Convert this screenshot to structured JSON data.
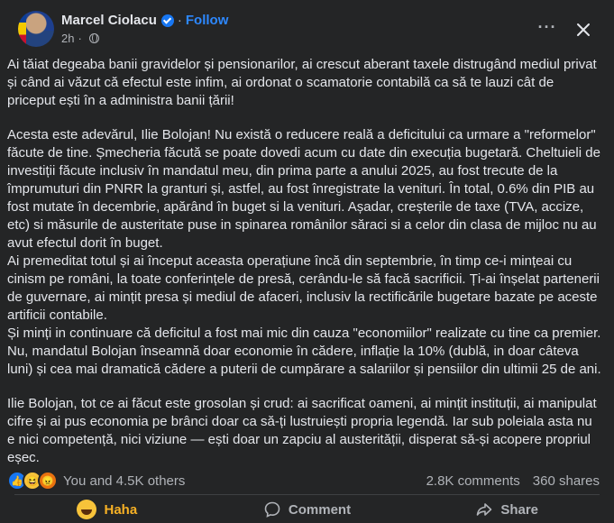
{
  "post": {
    "author": "Marcel Ciolacu",
    "separator": "·",
    "follow_label": "Follow",
    "time": "2h",
    "privacy_icon": "globe-icon",
    "more_icon": "more-horizontal-icon",
    "close_icon": "close-icon",
    "paragraphs": [
      "Ai tăiat degeaba banii gravidelor și pensionarilor, ai crescut aberant taxele distrugând mediul privat și când ai văzut că efectul este infim, ai ordonat o scamatorie contabilă ca să te lauzi cât de priceput ești în a administra banii țării!",
      "Acesta este adevărul, Ilie Bolojan! Nu există o reducere reală a deficitului ca urmare a \"reformelor\" făcute de tine. Șmecheria făcută se poate dovedi acum cu date din execuția bugetară.  Cheltuieli de investiții făcute inclusiv în mandatul meu, din prima parte a anului 2025, au fost trecute de la împrumuturi din PNRR la granturi și, astfel, au fost înregistrate la venituri. În total, 0.6% din PIB au fost mutate în decembrie, apărând în buget si la venituri. Așadar, creșterile de taxe (TVA, accize, etc) si măsurile de austeritate puse in spinarea românilor  săraci si a celor din clasa de mijloc nu au avut efectul dorit în buget.",
      "Ai premeditat totul și ai început aceasta operațiune încă din septembrie, în timp ce-i mințeai cu cinism pe români, la toate conferințele de presă, cerându-le să facă sacrificii. Ți-ai înșelat partenerii de guvernare, ai mințit presa și mediul de afaceri, inclusiv la rectificările bugetare bazate pe aceste artificii contabile.",
      "Și minți in continuare că deficitul a fost mai mic din cauza \"economiilor\" realizate cu tine ca premier. Nu, mandatul Bolojan înseamnă doar economie în cădere, inflație la 10% (dublă, in doar câteva luni) și cea mai dramatică cădere a puterii de cumpărare a salariilor și pensiilor din ultimii 25 de ani.",
      "Ilie Bolojan, tot ce ai făcut este grosolan și crud: ai sacrificat oameni, ai mințit instituții, ai manipulat cifre și ai pus economia pe brânci doar ca să-ți lustruiești propria legendă. Iar sub poleiala asta nu e nici competență, nici viziune — ești doar un zapciu al austerității, disperat să-și acopere propriul eșec."
    ]
  },
  "reactions": {
    "icons": [
      "like-icon",
      "haha-icon",
      "angry-icon"
    ],
    "summary": "You and 4.5K others",
    "comments": "2.8K comments",
    "shares": "360 shares"
  },
  "actions": {
    "haha_label": "Haha",
    "comment_label": "Comment",
    "share_label": "Share"
  },
  "colors": {
    "background": "#242526",
    "text": "#e4e6eb",
    "muted": "#b0b3b8",
    "link": "#2d88ff",
    "haha": "#f7b125"
  }
}
